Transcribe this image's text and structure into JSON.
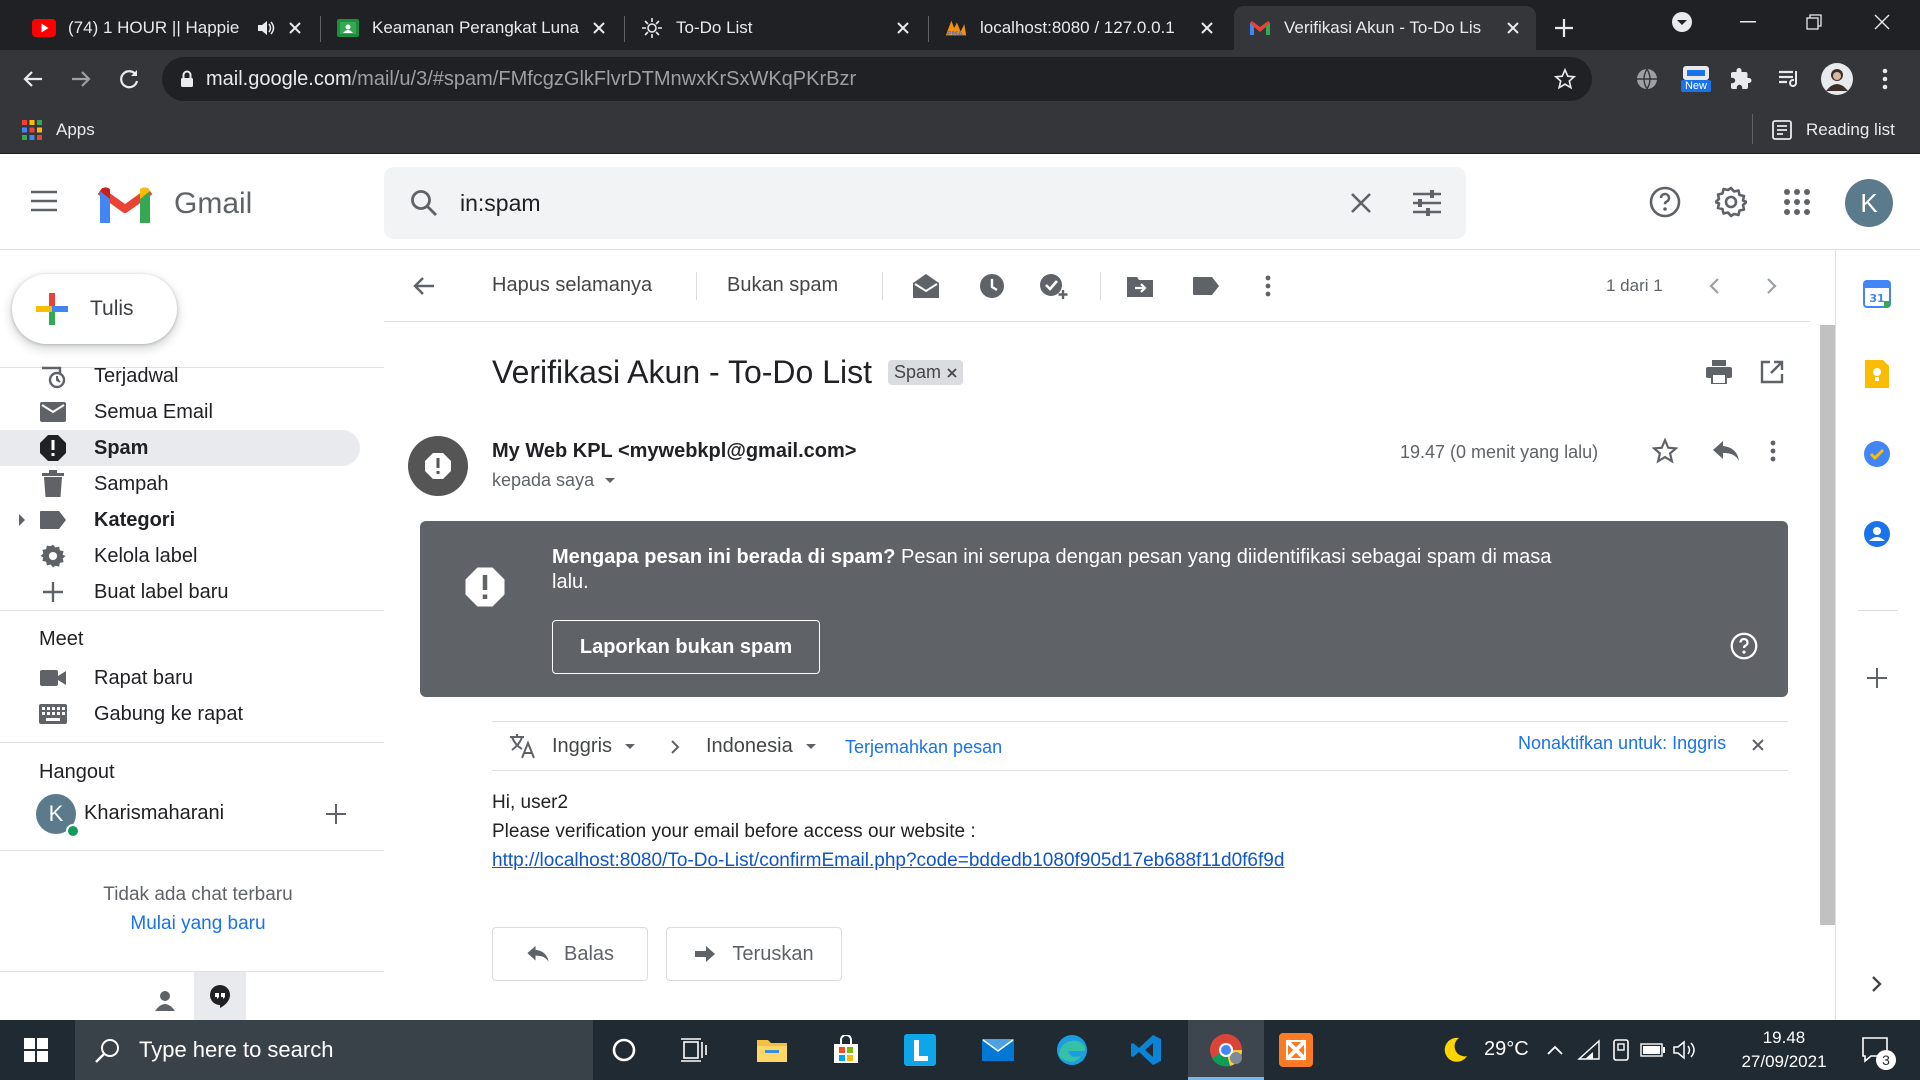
{
  "browser": {
    "tabs": [
      {
        "title": "(74) 1 HOUR || Happie",
        "icon": "youtube-icon"
      },
      {
        "title": "Keamanan Perangkat Luna",
        "icon": "classroom-icon"
      },
      {
        "title": "To-Do List",
        "icon": "sun-icon"
      },
      {
        "title": "localhost:8080 / 127.0.0.1",
        "icon": "phpmyadmin-icon"
      },
      {
        "title": "Verifikasi Akun - To-Do Lis",
        "icon": "gmail-icon",
        "active": true
      }
    ],
    "url_host": "mail.google.com",
    "url_path": "/mail/u/3/#spam/FMfcgzGlkFlvrDTMnwxKrSxWKqPKrBzr",
    "extension_badge": "New",
    "bookmarks": {
      "apps": "Apps",
      "reading_list": "Reading list"
    }
  },
  "gmail": {
    "logo_text": "Gmail",
    "search_query": "in:spam",
    "avatar_letter": "K",
    "compose_label": "Tulis",
    "nav": [
      {
        "label": "Terjadwal",
        "icon": "scheduled-icon"
      },
      {
        "label": "Semua Email",
        "icon": "all-mail-icon"
      },
      {
        "label": "Spam",
        "icon": "spam-icon",
        "active": true
      },
      {
        "label": "Sampah",
        "icon": "trash-icon"
      },
      {
        "label": "Kategori",
        "icon": "label-icon",
        "bold": true
      },
      {
        "label": "Kelola label",
        "icon": "gear-icon"
      },
      {
        "label": "Buat label baru",
        "icon": "plus-icon"
      }
    ],
    "meet": {
      "title": "Meet",
      "items": [
        {
          "label": "Rapat baru",
          "icon": "video-icon"
        },
        {
          "label": "Gabung ke rapat",
          "icon": "keyboard-icon"
        }
      ]
    },
    "hangout": {
      "title": "Hangout",
      "user_initial": "K",
      "user_name": "Kharismaharani",
      "no_chat": "Tidak ada chat terbaru",
      "start_new": "Mulai yang baru"
    },
    "toolbar": {
      "delete_forever": "Hapus selamanya",
      "not_spam": "Bukan spam",
      "pagination": "1 dari 1"
    },
    "email": {
      "subject": "Verifikasi Akun - To-Do List",
      "label": "Spam",
      "sender": "My Web KPL <mywebkpl@gmail.com>",
      "to": "kepada saya",
      "time": "19.47 (0 menit yang lalu)",
      "spam_notice_bold": "Mengapa pesan ini berada di spam?",
      "spam_notice_text": " Pesan ini serupa dengan pesan yang diidentifikasi sebagai spam di masa lalu.",
      "report_not_spam": "Laporkan bukan spam",
      "translate": {
        "from": "Inggris",
        "to": "Indonesia",
        "action": "Terjemahkan pesan",
        "disable": "Nonaktifkan untuk: Inggris"
      },
      "body_greeting": "Hi, user2",
      "body_text": "Please verification your email before access our website :",
      "body_link": "http://localhost:8080/To-Do-List/confirmEmail.php?code=bddedb1080f905d17eb688f11d0f6f9d",
      "reply": "Balas",
      "forward": "Teruskan"
    }
  },
  "taskbar": {
    "search_placeholder": "Type here to search",
    "weather": "29°C",
    "time": "19.48",
    "date": "27/09/2021",
    "notification_count": "3"
  }
}
